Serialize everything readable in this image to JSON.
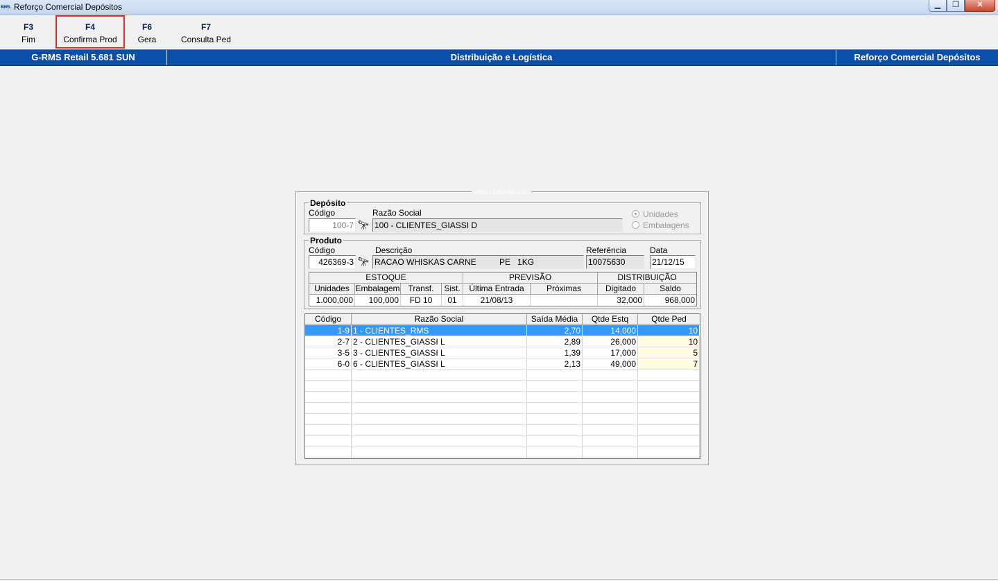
{
  "window": {
    "app_icon": "RMS",
    "title": "Reforço Comercial Depósitos",
    "controls": {
      "minimize": "▁",
      "restore": "❐",
      "close": "✕"
    }
  },
  "toolbar": {
    "keys": [
      {
        "key": "F3",
        "label": "Fim"
      },
      {
        "key": "F4",
        "label": "Confirma Prod"
      },
      {
        "key": "F6",
        "label": "Gera"
      },
      {
        "key": "F7",
        "label": "Consulta Ped"
      }
    ]
  },
  "header": {
    "left": "G-RMS Retail 5.681  SUN",
    "center": "Distribuição e Logística",
    "right": "Reforço Comercial Depósitos"
  },
  "panel": {
    "caption": "Modo Distribuição",
    "deposito": {
      "title": "Depósito",
      "codigo_label": "Código",
      "codigo_value": "100-7",
      "razao_label": "Razão Social",
      "razao_value": "100 - CLIENTES_GIASSI D",
      "radio_unidades": "Unidades",
      "radio_embalagens": "Embalagens"
    },
    "produto": {
      "title": "Produto",
      "codigo_label": "Código",
      "codigo_value": "426369-3",
      "descricao_label": "Descrição",
      "descricao_value": "RACAO WHISKAS CARNE          PE   1KG",
      "referencia_label": "Referência",
      "referencia_value": "10075630",
      "data_label": "Data",
      "data_value": "21/12/15"
    },
    "stock": {
      "groups": {
        "estoque": "ESTOQUE",
        "previsao": "PREVISÃO",
        "distribuicao": "DISTRIBUIÇÃO"
      },
      "cols": {
        "unidades": "Unidades",
        "embalagem": "Embalagem",
        "transf": "Transf.",
        "sist": "Sist.",
        "ultima": "Última Entrada",
        "proximas": "Próximas Entregas",
        "digitado": "Digitado",
        "saldo": "Saldo"
      },
      "values": {
        "unidades": "1.000,000",
        "embalagem": "100,000",
        "transf": "FD 10",
        "sist": "01",
        "ultima": "21/08/13",
        "proximas": "",
        "digitado": "32,000",
        "saldo": "968,000"
      }
    },
    "grid": {
      "headers": {
        "codigo": "Código",
        "razao": "Razão Social",
        "saida": "Saída Média",
        "estq": "Qtde Estq",
        "ped": "Qtde Ped"
      },
      "rows": [
        {
          "codigo": "1-9",
          "razao": "1 - CLIENTES_RMS",
          "saida": "2,70",
          "estq": "14,000",
          "ped": "10"
        },
        {
          "codigo": "2-7",
          "razao": "2 - CLIENTES_GIASSI L",
          "saida": "2,89",
          "estq": "26,000",
          "ped": "10"
        },
        {
          "codigo": "3-5",
          "razao": "3 - CLIENTES_GIASSI L",
          "saida": "1,39",
          "estq": "17,000",
          "ped": "5"
        },
        {
          "codigo": "6-0",
          "razao": "6 - CLIENTES_GIASSI L",
          "saida": "2,13",
          "estq": "49,000",
          "ped": "7"
        }
      ]
    }
  },
  "colors": {
    "header_band": "#0b4fa8",
    "selection": "#3399ff",
    "highlight_cell": "#fffbe1",
    "active_key_border": "#e22a2a"
  }
}
